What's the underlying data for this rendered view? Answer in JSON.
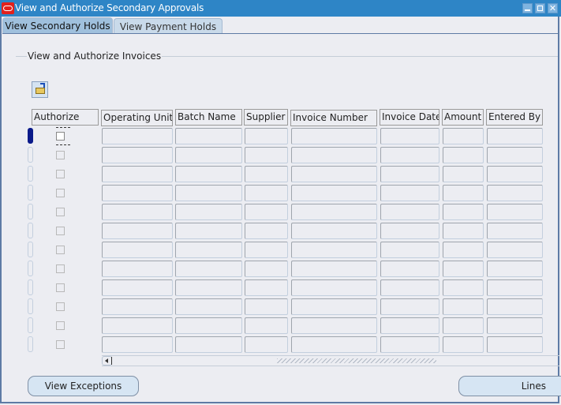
{
  "window": {
    "title": "View and Authorize Secondary Approvals",
    "controls": [
      "minimize",
      "maximize",
      "close"
    ]
  },
  "tabs": [
    {
      "label": "View Secondary Holds",
      "active": true
    },
    {
      "label": "View Payment Holds",
      "active": false
    }
  ],
  "group": {
    "label": "View and Authorize Invoices",
    "toolbar_icon": "open-folder-icon"
  },
  "table": {
    "columns": [
      "Authorize",
      "Operating Unit",
      "Batch Name",
      "Supplier",
      "Invoice Number",
      "Invoice Date",
      "Amount",
      "Entered By"
    ],
    "row_count": 12,
    "current_row": 1,
    "rows": [
      {
        "authorize": false,
        "operating_unit": "",
        "batch_name": "",
        "supplier": "",
        "invoice_number": "",
        "invoice_date": "",
        "amount": "",
        "entered_by": ""
      },
      {
        "authorize": false,
        "operating_unit": "",
        "batch_name": "",
        "supplier": "",
        "invoice_number": "",
        "invoice_date": "",
        "amount": "",
        "entered_by": ""
      },
      {
        "authorize": false,
        "operating_unit": "",
        "batch_name": "",
        "supplier": "",
        "invoice_number": "",
        "invoice_date": "",
        "amount": "",
        "entered_by": ""
      },
      {
        "authorize": false,
        "operating_unit": "",
        "batch_name": "",
        "supplier": "",
        "invoice_number": "",
        "invoice_date": "",
        "amount": "",
        "entered_by": ""
      },
      {
        "authorize": false,
        "operating_unit": "",
        "batch_name": "",
        "supplier": "",
        "invoice_number": "",
        "invoice_date": "",
        "amount": "",
        "entered_by": ""
      },
      {
        "authorize": false,
        "operating_unit": "",
        "batch_name": "",
        "supplier": "",
        "invoice_number": "",
        "invoice_date": "",
        "amount": "",
        "entered_by": ""
      },
      {
        "authorize": false,
        "operating_unit": "",
        "batch_name": "",
        "supplier": "",
        "invoice_number": "",
        "invoice_date": "",
        "amount": "",
        "entered_by": ""
      },
      {
        "authorize": false,
        "operating_unit": "",
        "batch_name": "",
        "supplier": "",
        "invoice_number": "",
        "invoice_date": "",
        "amount": "",
        "entered_by": ""
      },
      {
        "authorize": false,
        "operating_unit": "",
        "batch_name": "",
        "supplier": "",
        "invoice_number": "",
        "invoice_date": "",
        "amount": "",
        "entered_by": ""
      },
      {
        "authorize": false,
        "operating_unit": "",
        "batch_name": "",
        "supplier": "",
        "invoice_number": "",
        "invoice_date": "",
        "amount": "",
        "entered_by": ""
      },
      {
        "authorize": false,
        "operating_unit": "",
        "batch_name": "",
        "supplier": "",
        "invoice_number": "",
        "invoice_date": "",
        "amount": "",
        "entered_by": ""
      },
      {
        "authorize": false,
        "operating_unit": "",
        "batch_name": "",
        "supplier": "",
        "invoice_number": "",
        "invoice_date": "",
        "amount": "",
        "entered_by": ""
      }
    ]
  },
  "buttons": {
    "view_exceptions": "View Exceptions",
    "lines": "Lines"
  },
  "colors": {
    "titlebar": "#2E85C6",
    "active_tab": "#9FC0DD",
    "inactive_tab": "#C9DAEA",
    "background": "#ECEDF2",
    "current_row_indicator": "#0A1A8A",
    "button": "#D6E5F3"
  }
}
